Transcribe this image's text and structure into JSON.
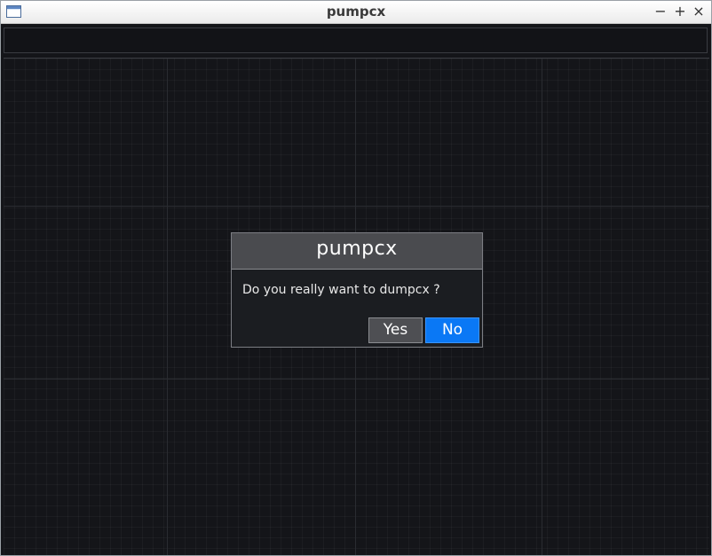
{
  "window": {
    "title": "pumpcx",
    "controls": {
      "minimize": "−",
      "maximize": "+",
      "close": "×"
    },
    "icon": "app-window-icon"
  },
  "dialog": {
    "title": "pumpcx",
    "message": "Do you really want to dumpcx ?",
    "yes_label": "Yes",
    "no_label": "No",
    "default_button": "No"
  },
  "colors": {
    "background": "#141519",
    "dialog_header": "#4a4b4f",
    "default_button": "#0a78f5",
    "secondary_button": "#4e4f53"
  }
}
